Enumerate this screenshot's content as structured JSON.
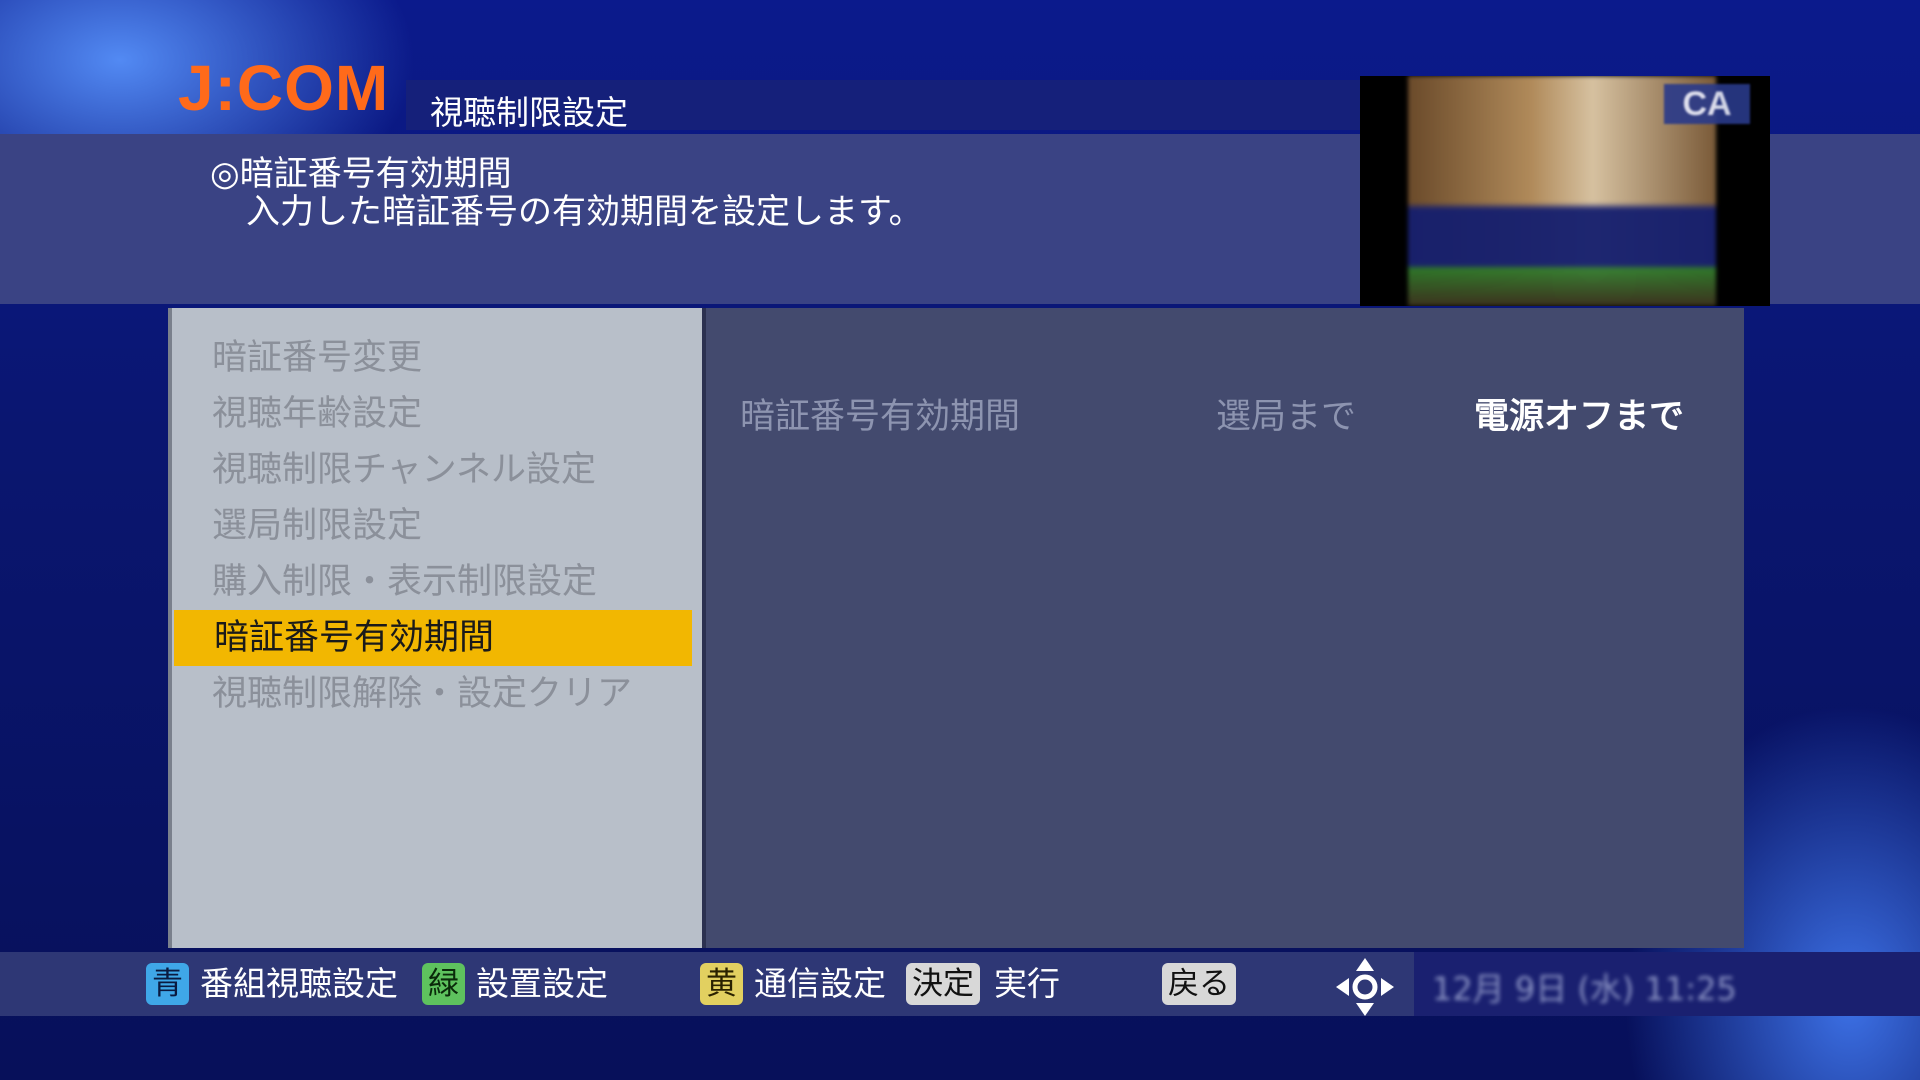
{
  "header": {
    "logo": "J:COM",
    "title": "視聴制限設定"
  },
  "info": {
    "heading": "◎暗証番号有効期間",
    "description": "入力した暗証番号の有効期間を設定します。"
  },
  "preview": {
    "channel_badge": "CA"
  },
  "menu": {
    "items": [
      {
        "label": "暗証番号変更"
      },
      {
        "label": "視聴年齢設定"
      },
      {
        "label": "視聴制限チャンネル設定"
      },
      {
        "label": "選局制限設定"
      },
      {
        "label": "購入制限・表示制限設定"
      },
      {
        "label": "暗証番号有効期間"
      },
      {
        "label": "視聴制限解除・設定クリア"
      }
    ],
    "selected_index": 5
  },
  "setting": {
    "label": "暗証番号有効期間",
    "options": [
      "選局まで",
      "電源オフまで"
    ],
    "selected_option": "電源オフまで"
  },
  "footer": {
    "blue_key": "青",
    "blue_label": "番組視聴設定",
    "green_key": "緑",
    "green_label": "設置設定",
    "yellow_key": "黄",
    "yellow_label": "通信設定",
    "enter_key": "決定",
    "enter_label": "実行",
    "back_key": "戻る",
    "clock": "12月 9日 (水) 11:25"
  },
  "colors": {
    "accent_selected": "#f2b701",
    "logo": "#ff6a1a",
    "blue_key": "#3fa7e8",
    "green_key": "#5ec25e",
    "yellow_key": "#e2d060"
  },
  "icons": {
    "dpad": "dpad-icon"
  }
}
